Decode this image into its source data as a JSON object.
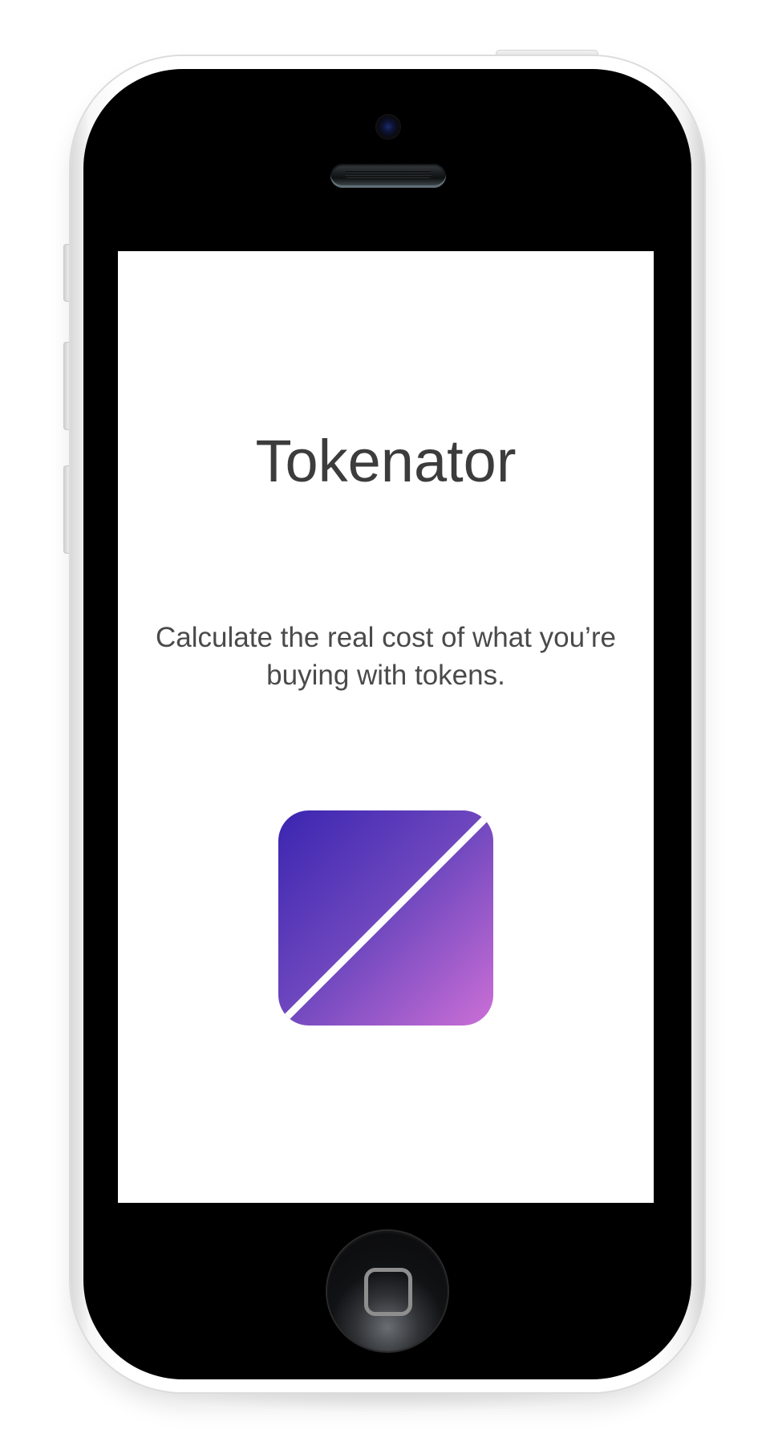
{
  "app": {
    "title": "Tokenator",
    "tagline": "Calculate the real cost of what you’re buying with tokens."
  },
  "logo": {
    "icon": "diagonal-split-square-icon",
    "gradient_start": "#3a25b0",
    "gradient_end": "#cc6fd6",
    "stripe_color": "#ffffff"
  },
  "device": {
    "model": "phone",
    "shell_color": "#ffffff",
    "front_color": "#000000",
    "home_button_icon": "rounded-square-icon"
  }
}
